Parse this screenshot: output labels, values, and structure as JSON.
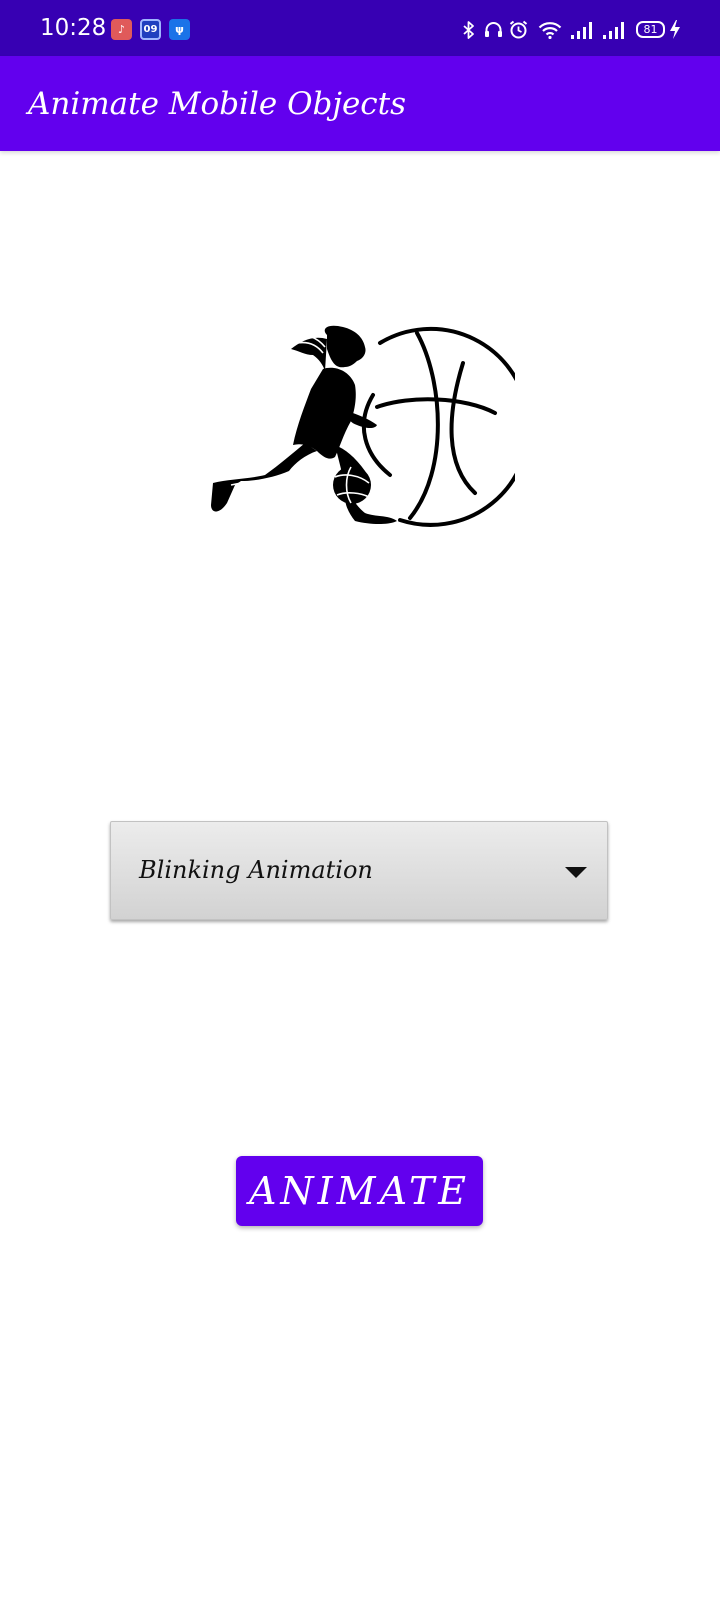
{
  "status_bar": {
    "time": "10:28",
    "calendar_day": "09",
    "battery_level": "81",
    "background_color": "#3700B3",
    "notification_icons": [
      "music-note-icon",
      "calendar-icon",
      "usb-icon"
    ],
    "system_icons": [
      "bluetooth-icon",
      "headphones-icon",
      "alarm-icon",
      "wifi-icon",
      "signal-icon",
      "signal-icon",
      "battery-icon",
      "charging-icon"
    ]
  },
  "app_bar": {
    "title": "Animate Mobile Objects",
    "background_color": "#6200EE"
  },
  "main": {
    "image": {
      "icon": "basketball-player-image"
    },
    "spinner": {
      "selected": "Blinking Animation",
      "icon": "dropdown-arrow-icon"
    },
    "animate_button": {
      "label": "ANIMATE",
      "color": "#6200EE"
    }
  }
}
